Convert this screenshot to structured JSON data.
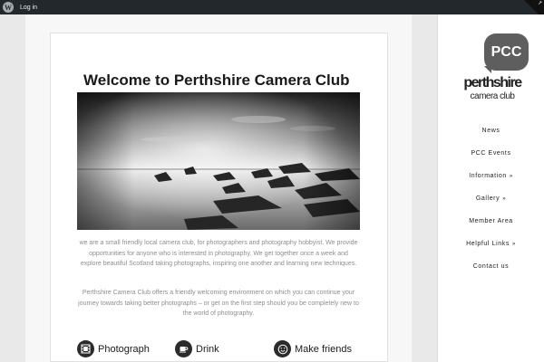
{
  "adminbar": {
    "login_label": "Log in",
    "logo_icon": "wordpress-icon"
  },
  "page": {
    "title": "Welcome to Perthshire Camera Club",
    "paragraphs": [
      "we are a small friendly local camera club, for photographers and photography hobbyist. We provide opportunities for anyone who is interested in photography.  We  get together once a week and explore beautiful Scotland taking photographs, inspiring one another and learning new techniques.",
      "Perthshire Camera Club offers a friendly welcoming environment on which you can continue your journey towards taking better photographs – or get on the first step should you be completely new to the world of photography."
    ],
    "features": [
      {
        "label": "Photograph",
        "icon": "film-icon"
      },
      {
        "label": "Drink",
        "icon": "coffee-cup-icon"
      },
      {
        "label": "Make friends",
        "icon": "smiley-icon"
      }
    ]
  },
  "logo": {
    "initials": "PCC",
    "line1": "perthshire",
    "line2": "camera club"
  },
  "nav": {
    "items": [
      {
        "label": "News",
        "has_submenu": false
      },
      {
        "label": "PCC Events",
        "has_submenu": false
      },
      {
        "label": "Information",
        "has_submenu": true
      },
      {
        "label": "Gallery",
        "has_submenu": true
      },
      {
        "label": "Member Area",
        "has_submenu": false
      },
      {
        "label": "Helpful Links",
        "has_submenu": true
      },
      {
        "label": "Contact us",
        "has_submenu": false
      }
    ],
    "chevron": "»"
  },
  "colors": {
    "adminbar": "#23282d",
    "accent_dark": "#2b2b2b",
    "logo_bubble": "#5e5e5e"
  }
}
